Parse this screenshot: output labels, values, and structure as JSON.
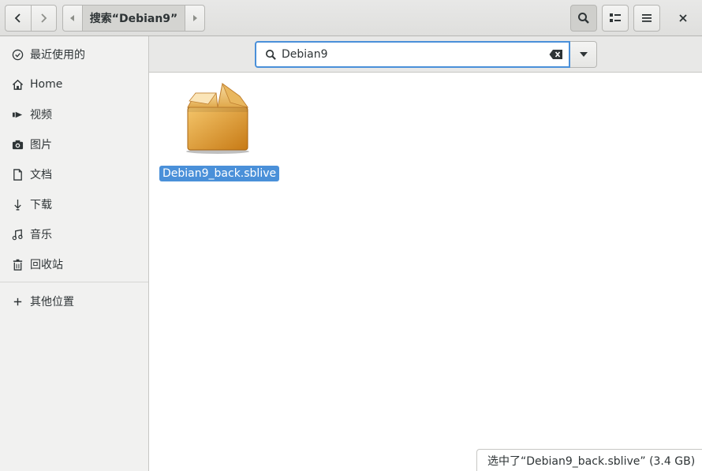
{
  "header": {
    "path_crumb": "搜索“Debian9”"
  },
  "sidebar": {
    "items": [
      {
        "label": "最近使用的",
        "icon": "recent-clock-icon"
      },
      {
        "label": "Home",
        "icon": "home-icon"
      },
      {
        "label": "视频",
        "icon": "video-icon"
      },
      {
        "label": "图片",
        "icon": "camera-icon"
      },
      {
        "label": "文档",
        "icon": "document-icon"
      },
      {
        "label": "下载",
        "icon": "download-icon"
      },
      {
        "label": "音乐",
        "icon": "music-icon"
      },
      {
        "label": "回收站",
        "icon": "trash-icon"
      }
    ],
    "other_locations": {
      "label": "其他位置",
      "icon": "plus-icon"
    }
  },
  "search": {
    "value": "Debian9"
  },
  "files": [
    {
      "name": "Debian9_back.sblive",
      "icon": "package-box-icon",
      "selected": true
    }
  ],
  "status": {
    "text": "选中了“Debian9_back.sblive” (3.4 GB)"
  },
  "colors": {
    "accent": "#4a90d9",
    "sidebar_bg": "#f1f1f0",
    "header_bg": "#e8e8e7"
  }
}
